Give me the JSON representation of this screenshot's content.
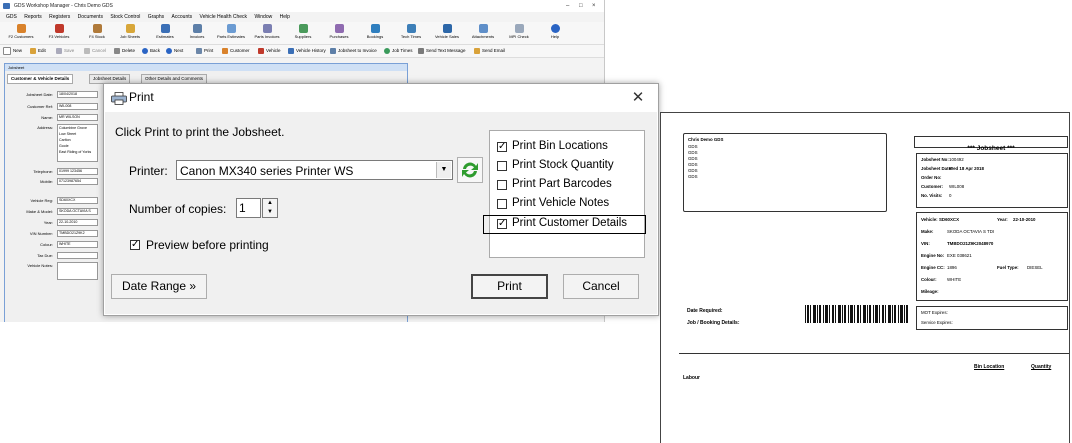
{
  "app": {
    "title": "GDS Workshop Manager - Chris Demo GDS",
    "window_controls": [
      "–",
      "□",
      "×"
    ],
    "menu": [
      "GDS",
      "Reports",
      "Registers",
      "Documents",
      "Stock Control",
      "Graphs",
      "Accounts",
      "Vehicle Health Check",
      "Window",
      "Help"
    ],
    "ribbon": [
      {
        "label": "F2 Customers",
        "icon": "customers-icon"
      },
      {
        "label": "F3 Vehicles",
        "icon": "vehicles-icon"
      },
      {
        "label": "F4 Stock",
        "icon": "stock-icon"
      },
      {
        "label": "Job Sheets",
        "icon": "jobsheets-icon"
      },
      {
        "label": "Estimates",
        "icon": "estimates-icon"
      },
      {
        "label": "Invoices",
        "icon": "invoices-icon"
      },
      {
        "label": "Parts Estimates",
        "icon": "parts-estimates-icon"
      },
      {
        "label": "Parts Invoices",
        "icon": "parts-invoices-icon"
      },
      {
        "label": "Suppliers",
        "icon": "suppliers-icon"
      },
      {
        "label": "Purchases",
        "icon": "purchases-icon"
      },
      {
        "label": "Bookings",
        "icon": "bookings-icon"
      },
      {
        "label": "Tech Times",
        "icon": "tech-times-icon"
      },
      {
        "label": "Vehicle Sales",
        "icon": "vehicle-sales-icon"
      },
      {
        "label": "Attachments",
        "icon": "attachments-icon"
      },
      {
        "label": "MPI Check",
        "icon": "mpi-check-icon"
      },
      {
        "label": "Help",
        "icon": "help-icon"
      }
    ],
    "toolbar": [
      "New",
      "Edit",
      "Save",
      "Cancel",
      "Delete",
      "Back",
      "Next",
      "Print",
      "Customer",
      "Vehicle",
      "Vehicle History",
      "Jobsheet to Invoice",
      "Job Times",
      "Send Text Message",
      "Send Email"
    ],
    "jobsheet": {
      "title": "Jobsheet",
      "tabs": [
        "Customer & Vehicle Details",
        "Jobsheet Details",
        "Other Details and Comments"
      ],
      "fields": [
        {
          "label": "Jobsheet Date:",
          "value": "18/04/2018"
        },
        {
          "label": "Customer Ref:",
          "value": "WIL008"
        },
        {
          "label": "Name:",
          "value": "MR WILSON"
        },
        {
          "label": "Address:",
          "value": "Columbine Grove"
        },
        {
          "label": "",
          "value": "Low Street"
        },
        {
          "label": "",
          "value": "Carlton"
        },
        {
          "label": "",
          "value": "Goole"
        },
        {
          "label": "",
          "value": "East Riding of Yorks"
        },
        {
          "label": "Telephone:",
          "value": "01999 123456"
        },
        {
          "label": "Mobile:",
          "value": "07123987654"
        },
        {
          "label": "Vehicle Reg:",
          "value": "SD60XCX"
        },
        {
          "label": "Make & Model:",
          "value": "SKODA OCTAVIA S"
        },
        {
          "label": "Year:",
          "value": "22-10-2010"
        },
        {
          "label": "VIN Number:",
          "value": "TMBDO21Z9K2"
        },
        {
          "label": "Colour:",
          "value": "WHITE"
        },
        {
          "label": "Tax Due:",
          "value": ""
        },
        {
          "label": "Vehicle Notes:",
          "value": ""
        }
      ]
    }
  },
  "dialog": {
    "title": "Print",
    "close_glyph": "✕",
    "instruction": "Click Print to print the Jobsheet.",
    "printer_label": "Printer:",
    "printer_value": "Canon MX340 series Printer WS",
    "copies_label": "Number of copies:",
    "copies_value": "1",
    "preview_label": "Preview before printing",
    "preview_checked": true,
    "options": [
      {
        "label": "Print Bin Locations",
        "checked": true
      },
      {
        "label": "Print Stock Quantity",
        "checked": false
      },
      {
        "label": "Print Part Barcodes",
        "checked": false
      },
      {
        "label": "Print Vehicle Notes",
        "checked": false
      },
      {
        "label": "Print Customer Details",
        "checked": true
      }
    ],
    "check_glyph": "✓",
    "date_range_label": "Date Range »",
    "print_label": "Print",
    "cancel_label": "Cancel",
    "spin_up": "▲",
    "spin_down": "▼",
    "dropdown_glyph": "▼"
  },
  "preview": {
    "company": "Chris Demo GDS",
    "company_lines": [
      "GDS",
      "GDS",
      "GDS",
      "GDS",
      "GDS",
      "GDS"
    ],
    "heading": "*** Jobsheet ***",
    "job_info": [
      {
        "label": "Jobsheet No:",
        "value": "100492"
      },
      {
        "label": "Jobsheet Date:",
        "value": "Wed 18 Apr 2018"
      },
      {
        "label": "Order No:",
        "value": ""
      },
      {
        "label": "Customer:",
        "value": "WIL008"
      },
      {
        "label": "No. Visits:",
        "value": "0"
      }
    ],
    "vehicle": {
      "vehicle_label": "Vehicle:",
      "vehicle_value": "SD60XCX",
      "year_label": "Year:",
      "year_value": "22-10-2010",
      "make_label": "Make:",
      "make_value": "SKODA OCTAVIA S TDI",
      "vin_label": "VIN:",
      "vin_value": "TMBDO21Z9K2048970",
      "engine_no_label": "Engine No:",
      "engine_no_value": "EXE 038621",
      "engine_cc_label": "Engine CC:",
      "engine_cc_value": "1896",
      "fuel_label": "Fuel Type:",
      "fuel_value": "DIESEL",
      "colour_label": "Colour:",
      "colour_value": "WHITE",
      "mileage_label": "Mileage:",
      "mileage_value": ""
    },
    "date_required": "Date Required:",
    "job_booking": "Job / Booking Details:",
    "mot_expires": "MOT Expires:",
    "service_expires": "Service Expires:",
    "labour": "Labour",
    "bin_location": "Bin Location",
    "quantity": "Quantity"
  },
  "colors": {
    "accent": "#3b6fb6",
    "refresh_green": "#2e9c2e",
    "dialog_body": "#f0f0f0"
  }
}
